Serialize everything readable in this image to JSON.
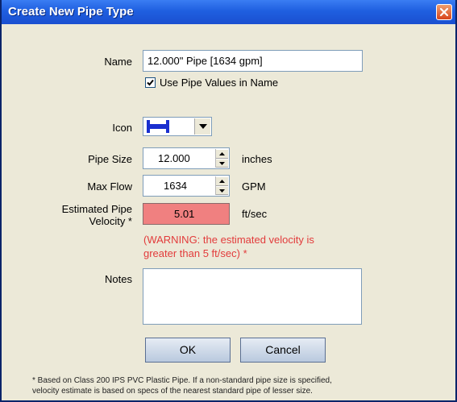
{
  "window": {
    "title": "Create New Pipe Type"
  },
  "form": {
    "name_label": "Name",
    "name_value": "12.000\" Pipe [1634 gpm]",
    "use_pipe_values_label": "Use Pipe Values in Name",
    "use_pipe_values_checked": true,
    "icon_label": "Icon",
    "icon_selected": "pipe-icon",
    "pipe_size_label": "Pipe Size",
    "pipe_size_value": "12.000",
    "pipe_size_unit": "inches",
    "max_flow_label": "Max Flow",
    "max_flow_value": "1634",
    "max_flow_unit": "GPM",
    "velocity_label_line1": "Estimated Pipe",
    "velocity_label_line2": "Velocity *",
    "velocity_value": "5.01",
    "velocity_unit": "ft/sec",
    "warning_line1": "(WARNING: the estimated velocity is",
    "warning_line2": "greater than 5 ft/sec) *",
    "notes_label": "Notes",
    "notes_value": ""
  },
  "buttons": {
    "ok_label": "OK",
    "cancel_label": "Cancel"
  },
  "footnote": {
    "line1": "* Based on Class 200 IPS PVC Plastic Pipe.  If a non-standard pipe size is specified,",
    "line2": "velocity estimate is based on specs of the nearest standard pipe of lesser size."
  },
  "colors": {
    "title_bar": "#2a66e6",
    "warning_text": "#e23b3b",
    "velocity_field_bg": "#f08080",
    "dialog_bg": "#ece9d8",
    "icon_blue": "#1a2fcf"
  }
}
